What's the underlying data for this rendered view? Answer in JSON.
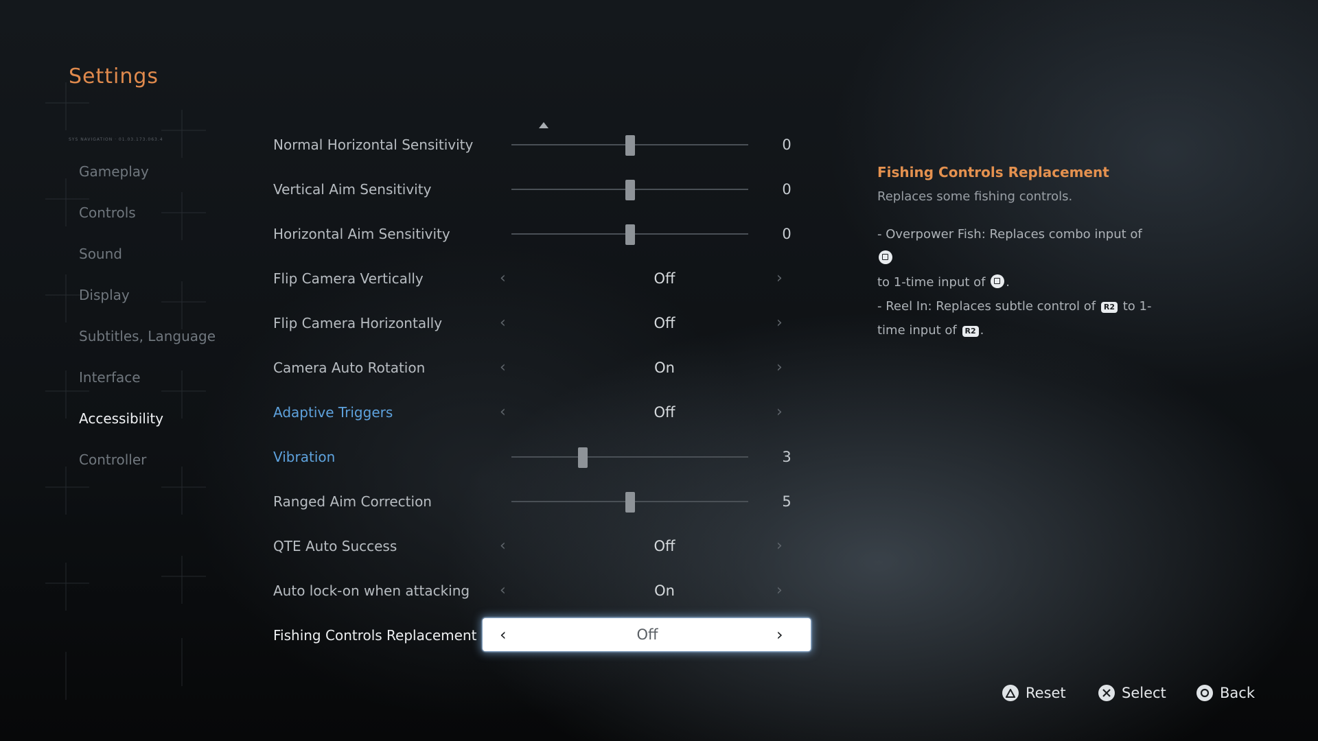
{
  "header": {
    "title": "Settings"
  },
  "deco_text": "SYS NAVIGATION · 01.03.173.063.4",
  "nav": {
    "items": [
      {
        "label": "Gameplay"
      },
      {
        "label": "Controls"
      },
      {
        "label": "Sound"
      },
      {
        "label": "Display"
      },
      {
        "label": "Subtitles, Language"
      },
      {
        "label": "Interface"
      },
      {
        "label": "Accessibility",
        "active": true
      },
      {
        "label": "Controller"
      }
    ]
  },
  "settings": [
    {
      "label": "Normal Horizontal Sensitivity",
      "type": "slider",
      "value": "0"
    },
    {
      "label": "Vertical Aim Sensitivity",
      "type": "slider",
      "value": "0"
    },
    {
      "label": "Horizontal Aim Sensitivity",
      "type": "slider",
      "value": "0"
    },
    {
      "label": "Flip Camera Vertically",
      "type": "toggle",
      "value": "Off"
    },
    {
      "label": "Flip Camera Horizontally",
      "type": "toggle",
      "value": "Off"
    },
    {
      "label": "Camera Auto Rotation",
      "type": "toggle",
      "value": "On"
    },
    {
      "label": "Adaptive Triggers",
      "type": "toggle",
      "value": "Off"
    },
    {
      "label": "Vibration",
      "type": "slider",
      "value": "3"
    },
    {
      "label": "Ranged Aim Correction",
      "type": "slider",
      "value": "5"
    },
    {
      "label": "QTE Auto Success",
      "type": "toggle",
      "value": "Off"
    },
    {
      "label": "Auto lock-on when attacking",
      "type": "toggle",
      "value": "On"
    },
    {
      "label": "Fishing Controls Replacement",
      "type": "toggle",
      "value": "Off"
    }
  ],
  "description": {
    "title": "Fishing Controls Replacement",
    "subtitle": "Replaces some fishing controls.",
    "lines": {
      "l1a": "- Overpower Fish: Replaces combo input of",
      "l1b": "to 1-time input of",
      "l1c": ".",
      "l2a": "- Reel In: Replaces subtle control of",
      "l2b": "to 1-",
      "l2c": "time input of",
      "l2d": "."
    },
    "r2_label": "R2"
  },
  "footer": {
    "reset": "Reset",
    "select": "Select",
    "back": "Back"
  },
  "colors": {
    "accent": "#e08a4d",
    "highlight_blue": "#5ea2dd",
    "selection_glow": "#8cbef0"
  },
  "icons": {
    "triangle": "triangle-button-icon",
    "cross": "cross-button-icon",
    "circle": "circle-button-icon",
    "square": "square-button-icon",
    "r2": "r2-button-icon"
  }
}
